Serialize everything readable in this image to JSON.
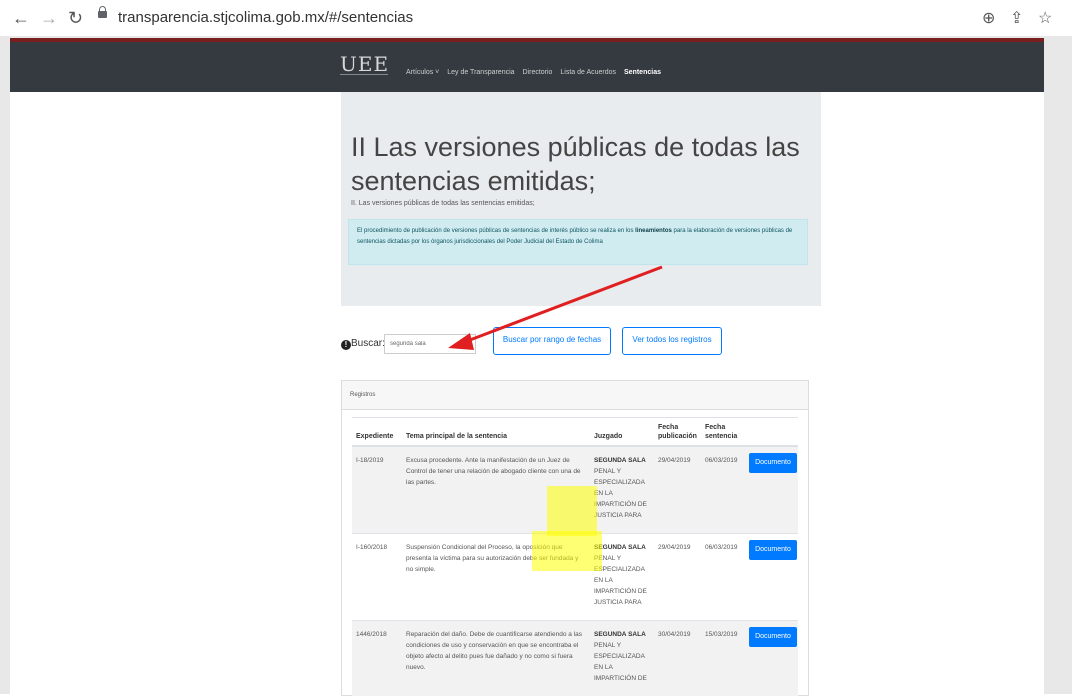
{
  "browser": {
    "url": "transparencia.stjcolima.gob.mx/#/sentencias"
  },
  "navbar": {
    "logo_text": "UEE",
    "links": [
      "Artículos ˅",
      "Ley de Transparencia",
      "Directorio",
      "Lista de Acuerdos",
      "Sentencias"
    ]
  },
  "jumbotron": {
    "title": "II Las versiones públicas de todas las sentencias emitidas;",
    "lead": "II. Las versiones públicas de todas las sentencias emitidas;",
    "alert_pre": "El procedimiento de publicación de versiones públicas de sentencias de interés público se realiza en los ",
    "alert_bold": "lineamientos",
    "alert_post": " para la elaboración de versiones públicas de sentencias dictadas por los órganos jurisdiccionales del Poder Judicial del Estado de Colima"
  },
  "search": {
    "label": "Buscar:",
    "value": "segunda sala",
    "date_range_button": "Buscar por rango de fechas",
    "all_records_button": "Ver todos los registros"
  },
  "records": {
    "header": "Registros",
    "columns": [
      "Expediente",
      "Tema principal de la sentencia",
      "Juzgado",
      "Fecha publicación",
      "Fecha sentencia"
    ],
    "document_button": "Documento",
    "rows": [
      {
        "expediente": "I-18/2019",
        "tema": "Excusa procedente. Ante la manifestación de un Juez de Control de tener una relación de abogado cliente con una de las partes.",
        "juzgado_bold": "SEGUNDA SALA",
        "juzgado_rest": "PENAL Y ESPECIALIZADA EN LA IMPARTICIÓN DE JUSTICIA PARA",
        "fecha_publicacion": "29/04/2019",
        "fecha_sentencia": "06/03/2019"
      },
      {
        "expediente": "I-160/2018",
        "tema": "Suspensión Condicional del Proceso, la oposición que presenta la víctima para su autorización debe ser fundada y no simple.",
        "juzgado_bold": "SEGUNDA SALA",
        "juzgado_rest": "PENAL Y ESPECIALIZADA EN LA IMPARTICIÓN DE JUSTICIA PARA",
        "fecha_publicacion": "29/04/2019",
        "fecha_sentencia": "06/03/2019"
      },
      {
        "expediente": "1446/2018",
        "tema": "Reparación del daño. Debe de cuantificarse atendiendo a las condiciones de uso y conservación en que se encontraba el objeto afecto al delito pues fue dañado y no como si fuera nuevo.",
        "juzgado_bold": "SEGUNDA SALA",
        "juzgado_rest": "PENAL Y ESPECIALIZADA EN LA IMPARTICIÓN DE",
        "fecha_publicacion": "30/04/2019",
        "fecha_sentencia": "15/03/2019"
      }
    ]
  },
  "colors": {
    "navbar": "#343a40",
    "primary": "#007bff",
    "alert_bg": "#d1ecf1",
    "arrow": "#e02020",
    "highlight": "#ffff00"
  }
}
